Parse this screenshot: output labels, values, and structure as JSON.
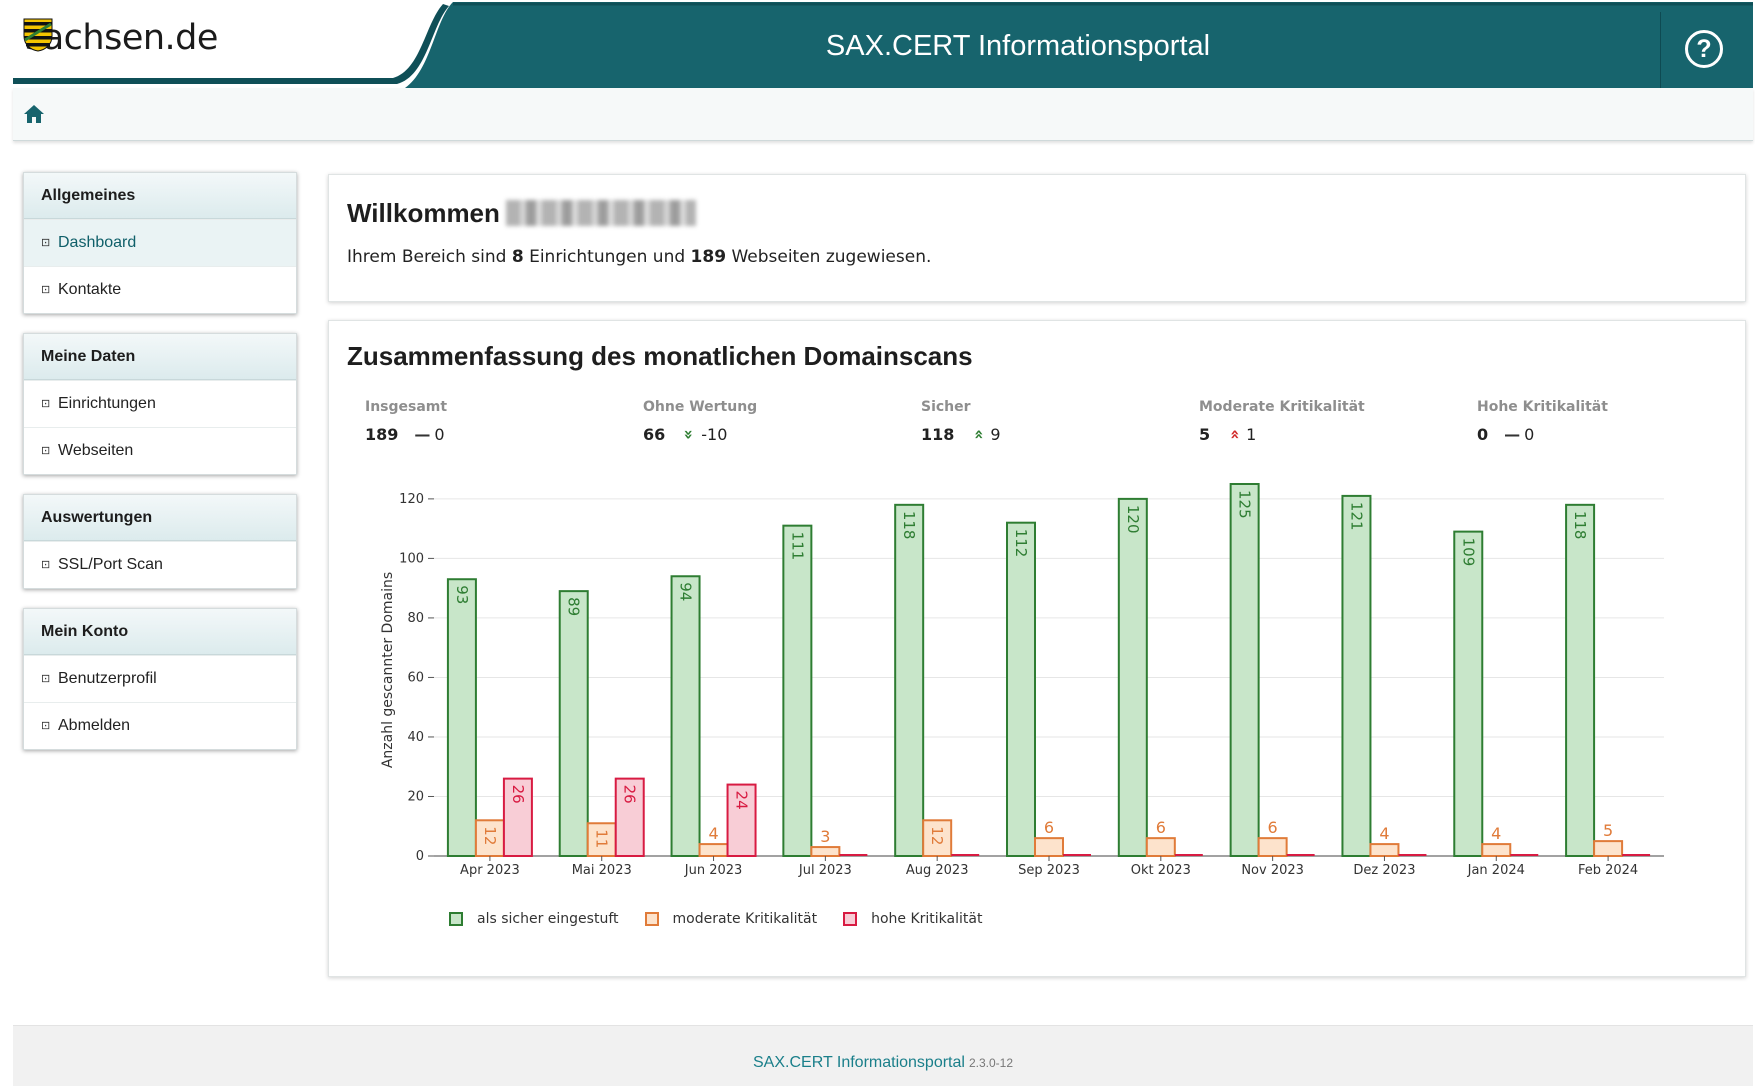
{
  "header": {
    "brand": "sachsen.de",
    "title": "SAX.CERT Informationsportal",
    "help": "?",
    "colors": {
      "teal": "#17646d",
      "teal_dark": "#0f4f57"
    }
  },
  "breadcrumb": {
    "home_icon": "home-icon"
  },
  "sidebar": [
    {
      "title": "Allgemeines",
      "items": [
        {
          "label": "Dashboard",
          "active": true
        },
        {
          "label": "Kontakte"
        }
      ]
    },
    {
      "title": "Meine Daten",
      "items": [
        {
          "label": "Einrichtungen"
        },
        {
          "label": "Webseiten"
        }
      ]
    },
    {
      "title": "Auswertungen",
      "items": [
        {
          "label": "SSL/Port Scan"
        }
      ]
    },
    {
      "title": "Mein Konto",
      "items": [
        {
          "label": "Benutzerprofil"
        },
        {
          "label": "Abmelden"
        }
      ]
    }
  ],
  "welcome": {
    "title": "Willkommen",
    "text_pre": "Ihrem Bereich sind ",
    "count_institutions": "8",
    "text_mid": " Einrichtungen und ",
    "count_websites": "189",
    "text_post": " Webseiten zugewiesen."
  },
  "scan": {
    "title": "Zusammenfassung des monatlichen Domainscans",
    "stats": [
      {
        "label": "Insgesamt",
        "value": "189",
        "trend": "flat",
        "delta": "0"
      },
      {
        "label": "Ohne Wertung",
        "value": "66",
        "trend": "down",
        "delta": "-10"
      },
      {
        "label": "Sicher",
        "value": "118",
        "trend": "up-green",
        "delta": "9"
      },
      {
        "label": "Moderate Kritikalität",
        "value": "5",
        "trend": "up-red",
        "delta": "1"
      },
      {
        "label": "Hohe Kritikalität",
        "value": "0",
        "trend": "flat",
        "delta": "0"
      }
    ]
  },
  "chart_data": {
    "type": "bar",
    "ylabel": "Anzahl gescannter Domains",
    "ylim": [
      0,
      125
    ],
    "yticks": [
      0,
      20,
      40,
      60,
      80,
      100,
      120
    ],
    "grid": true,
    "categories": [
      "Apr 2023",
      "Mai 2023",
      "Jun 2023",
      "Jul 2023",
      "Aug 2023",
      "Sep 2023",
      "Okt 2023",
      "Nov 2023",
      "Dez 2023",
      "Jan 2024",
      "Feb 2024"
    ],
    "series": [
      {
        "name": "als sicher eingestuft",
        "color": "#c8e6c9",
        "stroke": "#2e7d32",
        "values": [
          93,
          89,
          94,
          111,
          118,
          112,
          120,
          125,
          121,
          109,
          118
        ]
      },
      {
        "name": "moderate Kritikalität",
        "color": "#fde3cc",
        "stroke": "#e07b39",
        "values": [
          12,
          11,
          4,
          3,
          12,
          6,
          6,
          6,
          4,
          4,
          5
        ]
      },
      {
        "name": "hohe Kritikalität",
        "color": "#f8cdd6",
        "stroke": "#d81b42",
        "values": [
          26,
          26,
          24,
          0,
          0,
          0,
          0,
          0,
          0,
          0,
          0
        ]
      }
    ],
    "legend": "bottom-left"
  },
  "footer": {
    "link": "SAX.CERT Informationsportal",
    "version": "2.3.0-12"
  }
}
